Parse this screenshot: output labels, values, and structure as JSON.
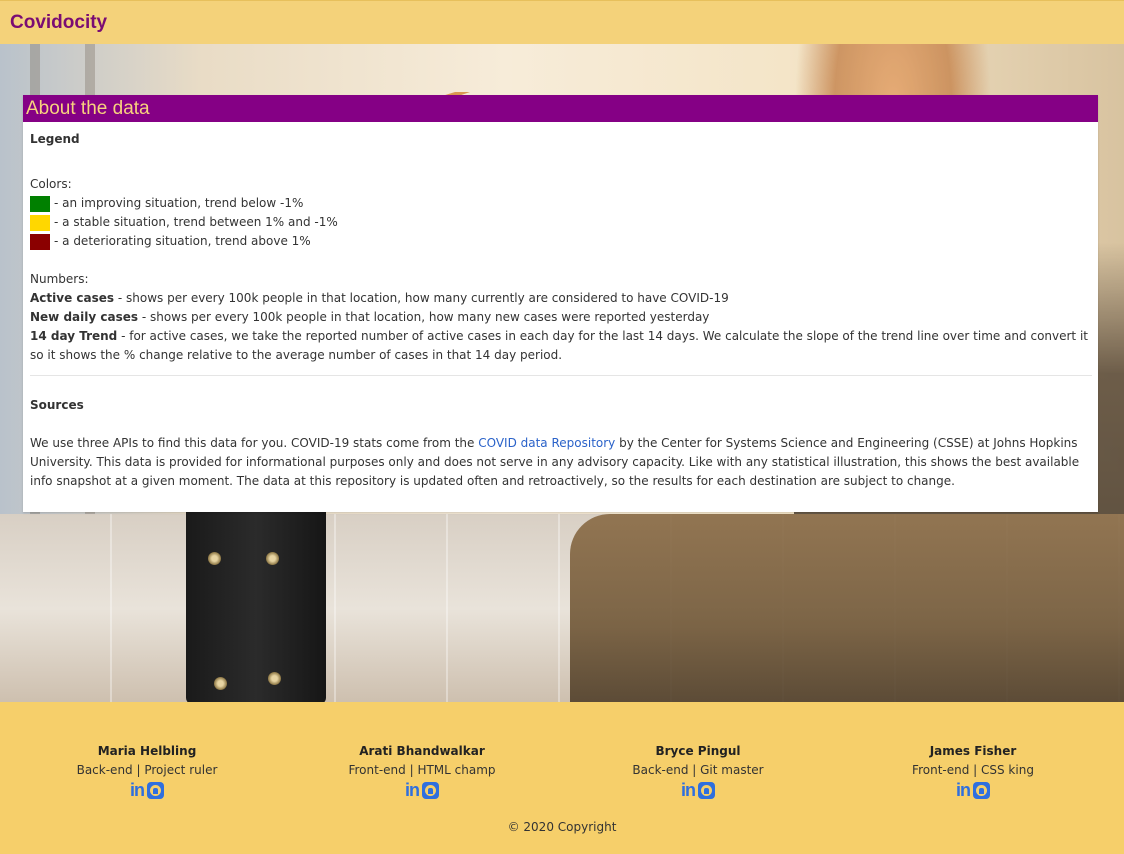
{
  "navbar": {
    "brand": "Covidocity"
  },
  "card": {
    "title": "About the data",
    "legend_title": "Legend",
    "colors_title": "Colors:",
    "colors": [
      {
        "color": "#008000",
        "label": "- an improving situation, trend below -1%"
      },
      {
        "color": "#FFD700",
        "label": "- a stable situation, trend between 1% and -1%"
      },
      {
        "color": "#8B0000",
        "label": "- a deteriorating situation, trend above 1%"
      }
    ],
    "numbers_title": "Numbers:",
    "numbers": [
      {
        "term": "Active cases",
        "desc": " - shows per every 100k people in that location, how many currently are considered to have COVID-19"
      },
      {
        "term": "New daily cases",
        "desc": " - shows per every 100k people in that location, how many new cases were reported yesterday"
      },
      {
        "term": "14 day Trend",
        "desc": " - for active cases, we take the reported number of active cases in each day for the last 14 days. We calculate the slope of the trend line over time and convert it so it shows the % change relative to the average number of cases in that 14 day period."
      }
    ],
    "sources_title": "Sources",
    "sources_before": "We use three APIs to find this data for you. COVID-19 stats come from the ",
    "sources_link": "COVID data Repository",
    "sources_after": " by the Center for Systems Science and Engineering (CSSE) at Johns Hopkins University. This data is provided for informational purposes only and does not serve in any advisory capacity. Like with any statistical illustration, this shows the best available info snapshot at a given moment. The data at this repository is updated often and retroactively, so the results for each destination are subject to change."
  },
  "footer": {
    "team": [
      {
        "name": "Maria Helbling",
        "role": "Back-end | Project ruler"
      },
      {
        "name": "Arati Bhandwalkar",
        "role": "Front-end | HTML champ"
      },
      {
        "name": "Bryce Pingul",
        "role": "Back-end | Git master"
      },
      {
        "name": "James Fisher",
        "role": "Front-end | CSS king"
      }
    ],
    "icons": [
      "linkedin-icon",
      "github-icon"
    ],
    "copyright": "© 2020 Copyright"
  }
}
